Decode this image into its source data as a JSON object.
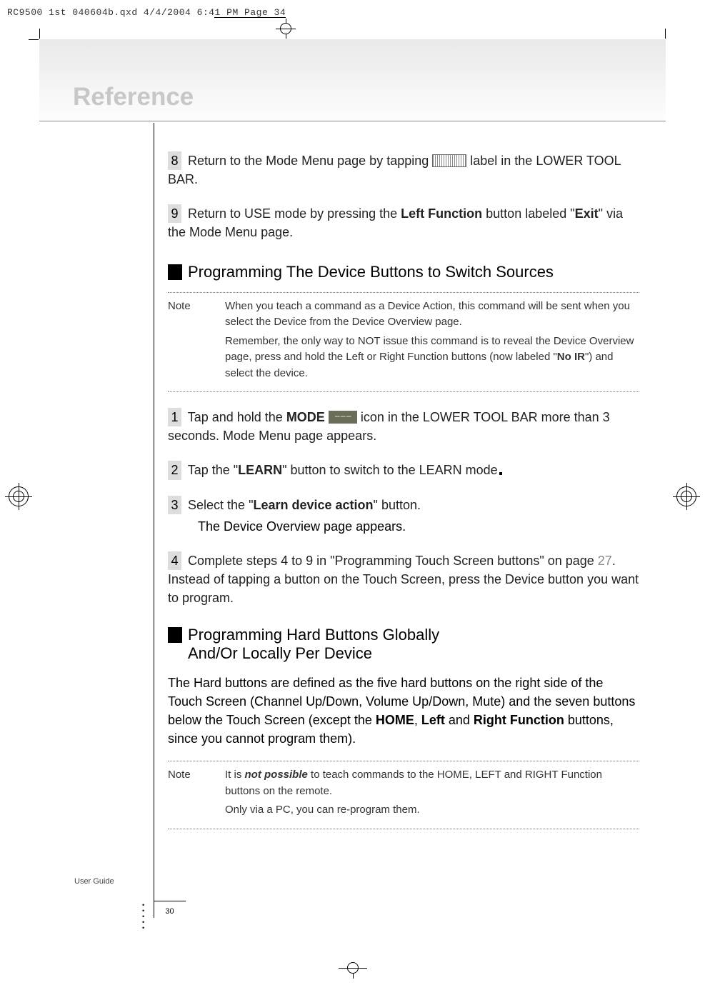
{
  "print_info": "RC9500 1st 040604b.qxd  4/4/2004  6:41 PM  Page 34",
  "chapter": "Reference",
  "steps_top": [
    {
      "num": "8",
      "pre": "Return to the Mode Menu page by tapping ",
      "post": " label in the LOWER TOOL BAR.",
      "has_label_icon": true
    },
    {
      "num": "9",
      "text_html": "Return to USE mode by pressing the <b>Left Function</b> button labeled \"<b>Exit</b>\" via the Mode Menu page."
    }
  ],
  "section1": {
    "title": "Programming The Device Buttons to Switch Sources",
    "note_label": "Note",
    "note_p1": "When you teach a command as a Device Action, this command will be sent when you select the Device from the Device Overview page.",
    "note_p2_html": "Remember, the only way to NOT issue this command is to reveal the Device Overview page, press and hold the Left or Right Function buttons (now labeled \"<b>No IR</b>\") and select the device.",
    "steps": [
      {
        "num": "1",
        "has_mode_icon": true,
        "pre": "Tap and hold the ",
        "mid_bold": "MODE",
        "between": " ",
        "post": " icon in the LOWER TOOL BAR more than 3 seconds. Mode Menu page appears."
      },
      {
        "num": "2",
        "text_html": "Tap the \"<b>LEARN</b>\" button to switch to the LEARN mode",
        "trailing_dot": true
      },
      {
        "num": "3",
        "text_html": "Select the \"<b>Learn device action</b>\" button.",
        "sub": "The Device Overview page appears."
      },
      {
        "num": "4",
        "text_html": "Complete steps 4 to 9 in \"Programming Touch Screen buttons\" on page <span class='page-link'>27</span>. Instead of tapping a button on the Touch Screen, press the Device button you want to program."
      }
    ]
  },
  "section2": {
    "title_line1": "Programming Hard Buttons Globally",
    "title_line2": "And/Or Locally Per Device",
    "body_html": "The Hard buttons are defined as the five hard buttons on the right side of the Touch Screen (Channel Up/Down, Volume Up/Down, Mute) and the seven buttons below the Touch Screen (except the <b>HOME</b>, <b>Left</b> and <b>Right Function</b> buttons, since you cannot program them).",
    "note_label": "Note",
    "note_p1_html": "It is <b><i>not possible</i></b> to teach commands to the HOME, LEFT and RIGHT Function buttons on the remote.",
    "note_p2": "Only via a PC, you can re-program them."
  },
  "footer_label": "User Guide",
  "page_number": "30",
  "chart_data": null
}
